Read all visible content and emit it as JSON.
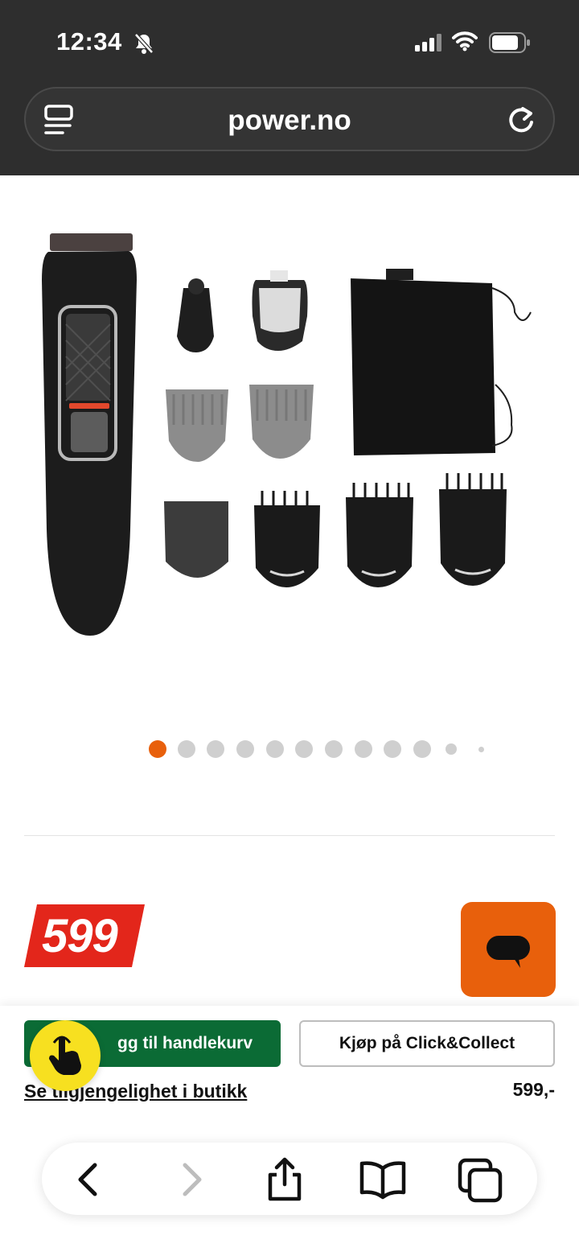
{
  "status_bar": {
    "time": "12:34"
  },
  "browser": {
    "url": "power.no"
  },
  "gallery": {
    "dot_count": 12,
    "active_index": 0
  },
  "product": {
    "price_badge": "599",
    "price": "599,-"
  },
  "actions": {
    "add_to_cart": "Legg til handlekurv",
    "add_to_cart_visible": "gg til handlekurv",
    "click_collect": "Kjøp på Click&Collect",
    "availability": "Se tilgjengelighet i butikk"
  },
  "colors": {
    "accent": "#e8600c",
    "price_red": "#e3261b",
    "cart_green": "#0b6b35",
    "touch_yellow": "#f7e020"
  },
  "icons": [
    "bell-slash-icon",
    "signal-icon",
    "wifi-icon",
    "battery-icon",
    "reader-icon",
    "reload-icon",
    "chat-icon",
    "touch-icon",
    "back-icon",
    "forward-icon",
    "share-icon",
    "bookmarks-icon",
    "tabs-icon"
  ]
}
